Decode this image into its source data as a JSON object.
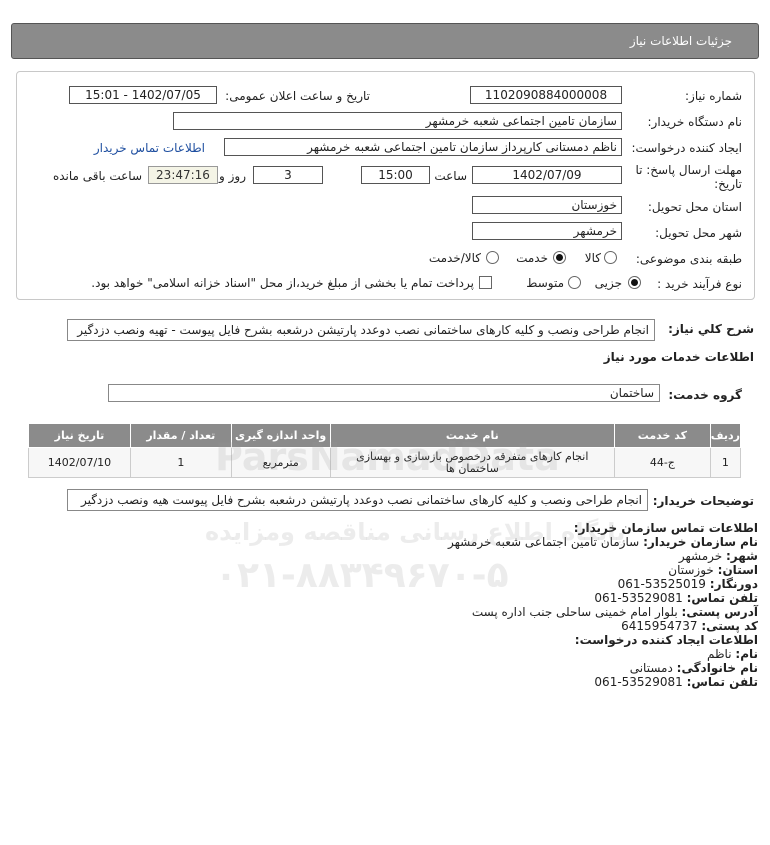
{
  "header": {
    "title": "جزئیات اطلاعات نیاز"
  },
  "form": {
    "need_number_label": "شماره نیاز:",
    "need_number": "1102090884000008",
    "announce_label": "تاریخ و ساعت اعلان عمومی:",
    "announce_value": "1402/07/05 - 15:01",
    "buyer_org_label": "نام دستگاه خریدار:",
    "buyer_org": "سازمان تامین اجتماعی شعبه خرمشهر",
    "creator_label": "ایجاد کننده درخواست:",
    "creator": "ناظم دمستانی کارپرداز سازمان تامین اجتماعی شعبه خرمشهر",
    "buyer_contact_link": "اطلاعات تماس خریدار",
    "deadline_label_1": "مهلت ارسال پاسخ: تا",
    "deadline_label_2": "تاریخ:",
    "deadline_date": "1402/07/09",
    "time_label": "ساعت",
    "deadline_time": "15:00",
    "days_value": "3",
    "days_label": "روز و",
    "remaining_time": "23:47:16",
    "remaining_label": "ساعت باقی مانده",
    "province_label": "استان محل تحویل:",
    "province": "خوزستان",
    "city_label": "شهر محل تحویل:",
    "city": "خرمشهر",
    "category_label": "طبقه بندی موضوعی:",
    "category_options": [
      "کالا",
      "خدمت",
      "کالا/خدمت"
    ],
    "category_selected": "خدمت",
    "process_label": "نوع فرآیند خرید :",
    "process_options": [
      "جزیی",
      "متوسط"
    ],
    "process_selected": "جزیی",
    "treasury_note": "پرداخت تمام یا بخشی از مبلغ خرید،از محل \"اسناد خزانه اسلامی\" خواهد بود."
  },
  "summary": {
    "label": "شرح کلي نياز:",
    "text": "انجام طراحی ونصب و کلیه کارهای ساختمانی نصب دوعدد پارتیشن درشعبه بشرح فایل پیوست - تهیه ونصب دزدگیر"
  },
  "services": {
    "section_title": "اطلاعات خدمات مورد نياز",
    "group_label": "گروه خدمت:",
    "group_value": "ساختمان",
    "table": {
      "headers": [
        "رديف",
        "کد خدمت",
        "نام خدمت",
        "واحد اندازه گیری",
        "تعداد / مقدار",
        "تاريخ نياز"
      ],
      "rows": [
        {
          "index": "1",
          "code": "ج-44",
          "name": "انجام کارهای متفرقه درخصوص بازسازی و بهسازی ساختمان ها",
          "unit": "مترمربع",
          "qty": "1",
          "date": "1402/07/10"
        }
      ]
    }
  },
  "buyer_notes": {
    "label": "توضیحات خریدار:",
    "text": "انجام طراحی ونصب و کلیه کارهای ساختمانی نصب دوعدد پارتیشن درشعبه بشرح فایل پیوست هیه ونصب دزدگیر"
  },
  "contact": {
    "org_heading": "اطلاعات تماس سازمان خریدار:",
    "org_name_label": "نام سازمان خریدار:",
    "org_name": "سازمان تامین اجتماعی شعبه خرمشهر",
    "city_label": "شهر:",
    "city": "خرمشهر",
    "province_label": "استان:",
    "province": "خوزستان",
    "fax_label": "دورنگار:",
    "fax": "061-53525019",
    "phone_label": "تلفن تماس:",
    "phone": "061-53529081",
    "address_label": "آدرس پستی:",
    "address": "بلوار امام خمینی ساحلی جنب اداره پست",
    "postal_label": "کد پستی:",
    "postal": "6415954737",
    "creator_heading": "اطلاعات ایجاد کننده درخواست:",
    "first_name_label": "نام:",
    "first_name": "ناظم",
    "last_name_label": "نام خانوادگی:",
    "last_name": "دمستانی",
    "creator_phone_label": "تلفن تماس:",
    "creator_phone": "061-53529081"
  },
  "watermark": {
    "brand": "ParsNamadData",
    "line1": "پایگاه اطلاع رسانی مناقصه ومزایده",
    "line2": "۰۲۱-۸۸۳۴۹۶۷۰-۵"
  }
}
